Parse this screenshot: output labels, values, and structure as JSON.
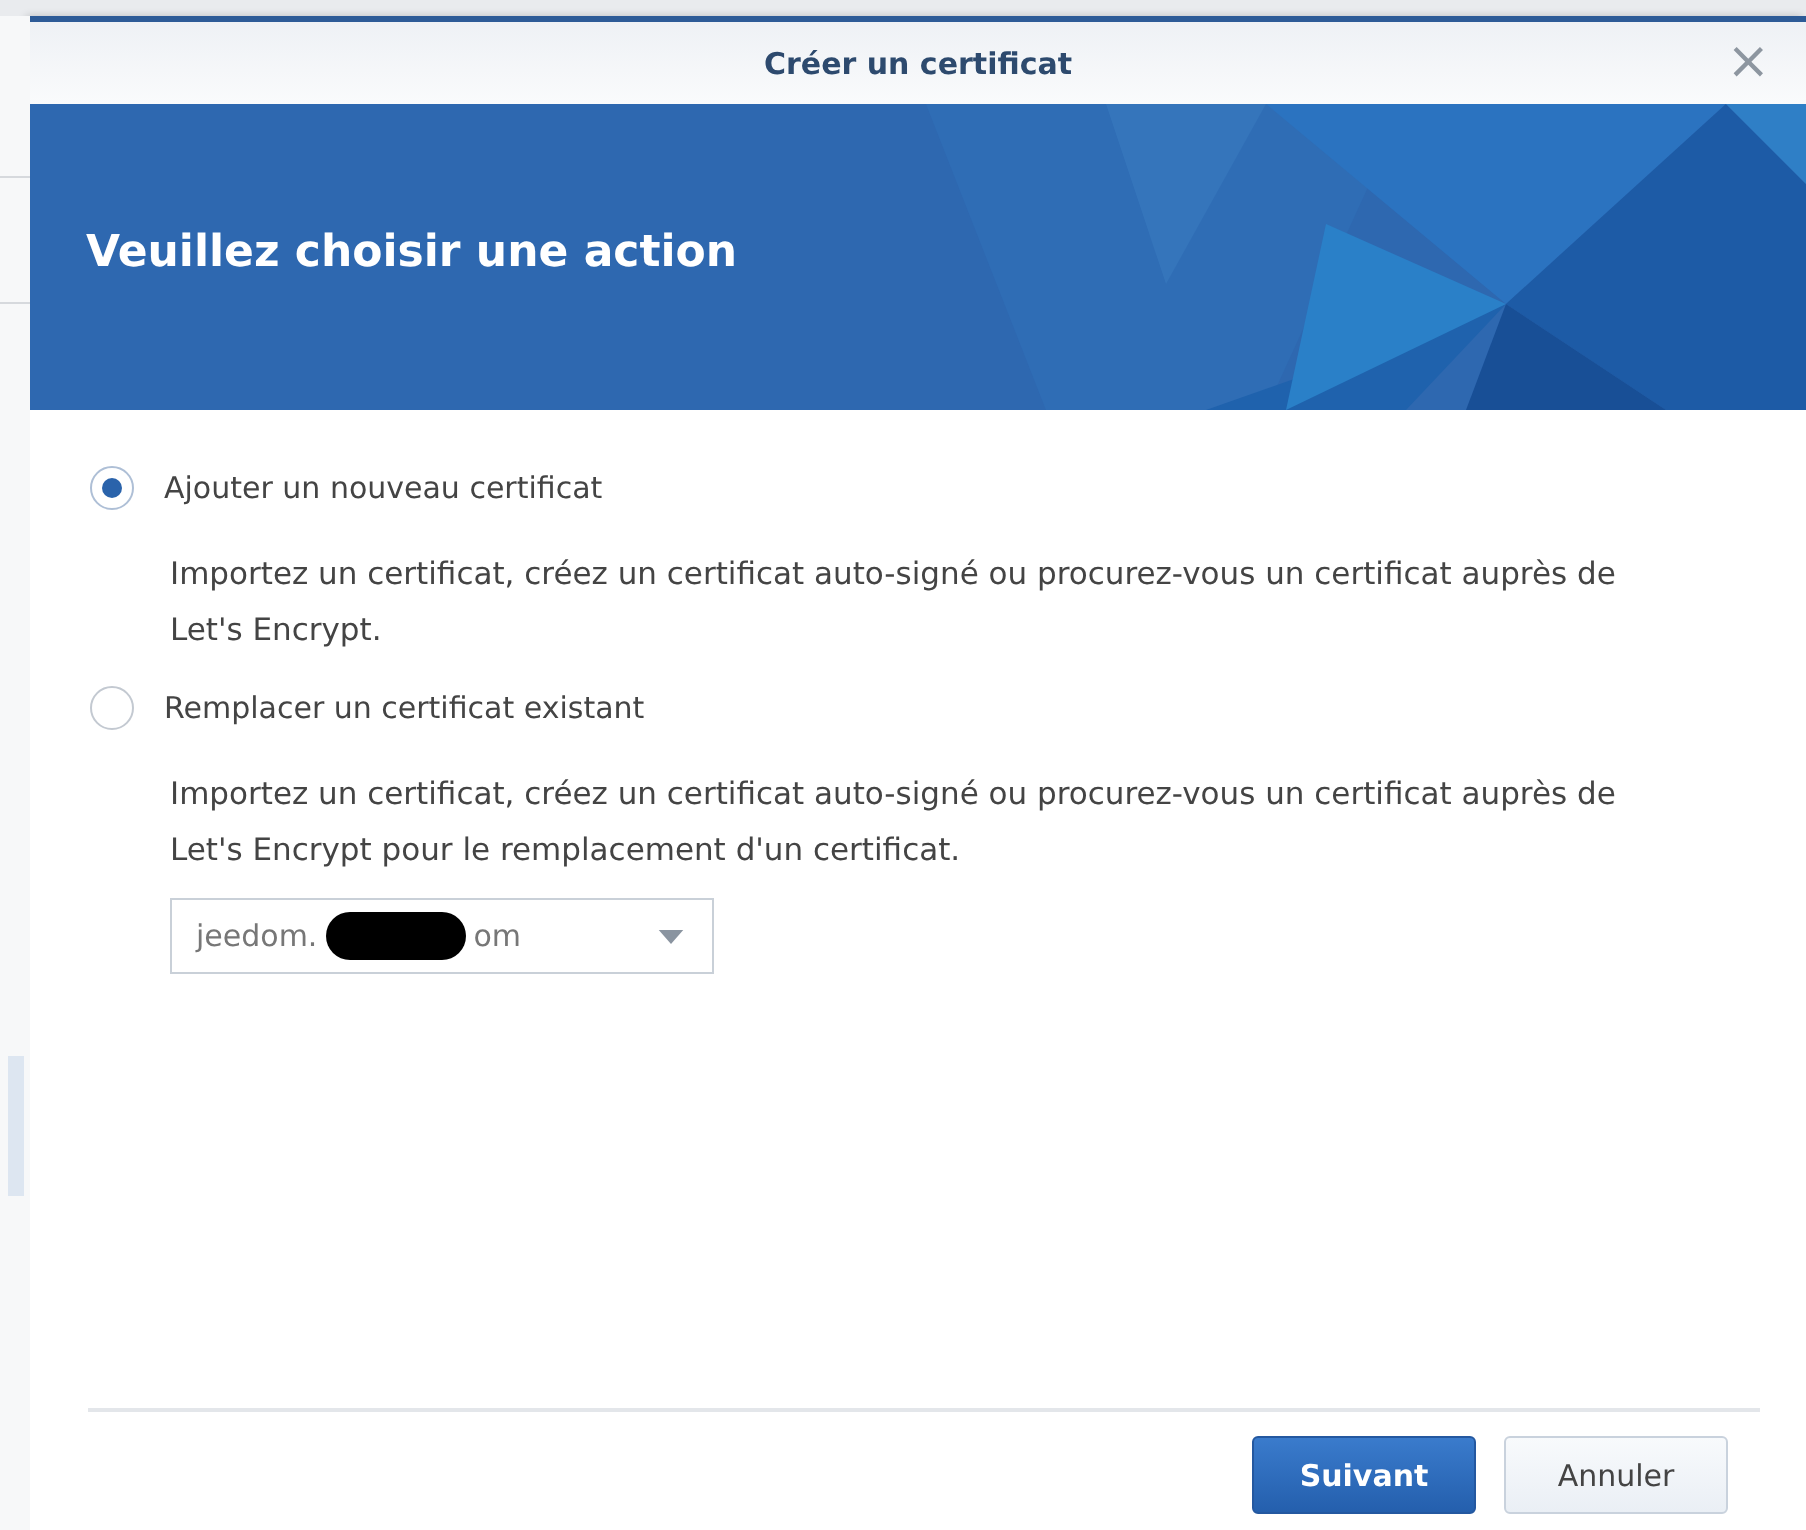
{
  "window": {
    "title": "Créer un certificat",
    "close": "×"
  },
  "banner": {
    "heading": "Veuillez choisir une action"
  },
  "options": [
    {
      "label": "Ajouter un nouveau certificat",
      "selected": true,
      "description": "Importez un certificat, créez un certificat auto-signé ou procurez-vous un certificat auprès de Let's Encrypt."
    },
    {
      "label": "Remplacer un certificat existant",
      "selected": false,
      "description": "Importez un certificat, créez un certificat auto-signé ou procurez-vous un certificat auprès de Let's Encrypt pour le remplacement d'un certificat.",
      "dropdown": {
        "value_start": "jeedom.",
        "redacted": true,
        "value_end": "om"
      }
    }
  ],
  "buttons": [
    {
      "label": "Suivant",
      "kind": "primary"
    },
    {
      "label": "Annuler",
      "kind": "secondary"
    }
  ]
}
